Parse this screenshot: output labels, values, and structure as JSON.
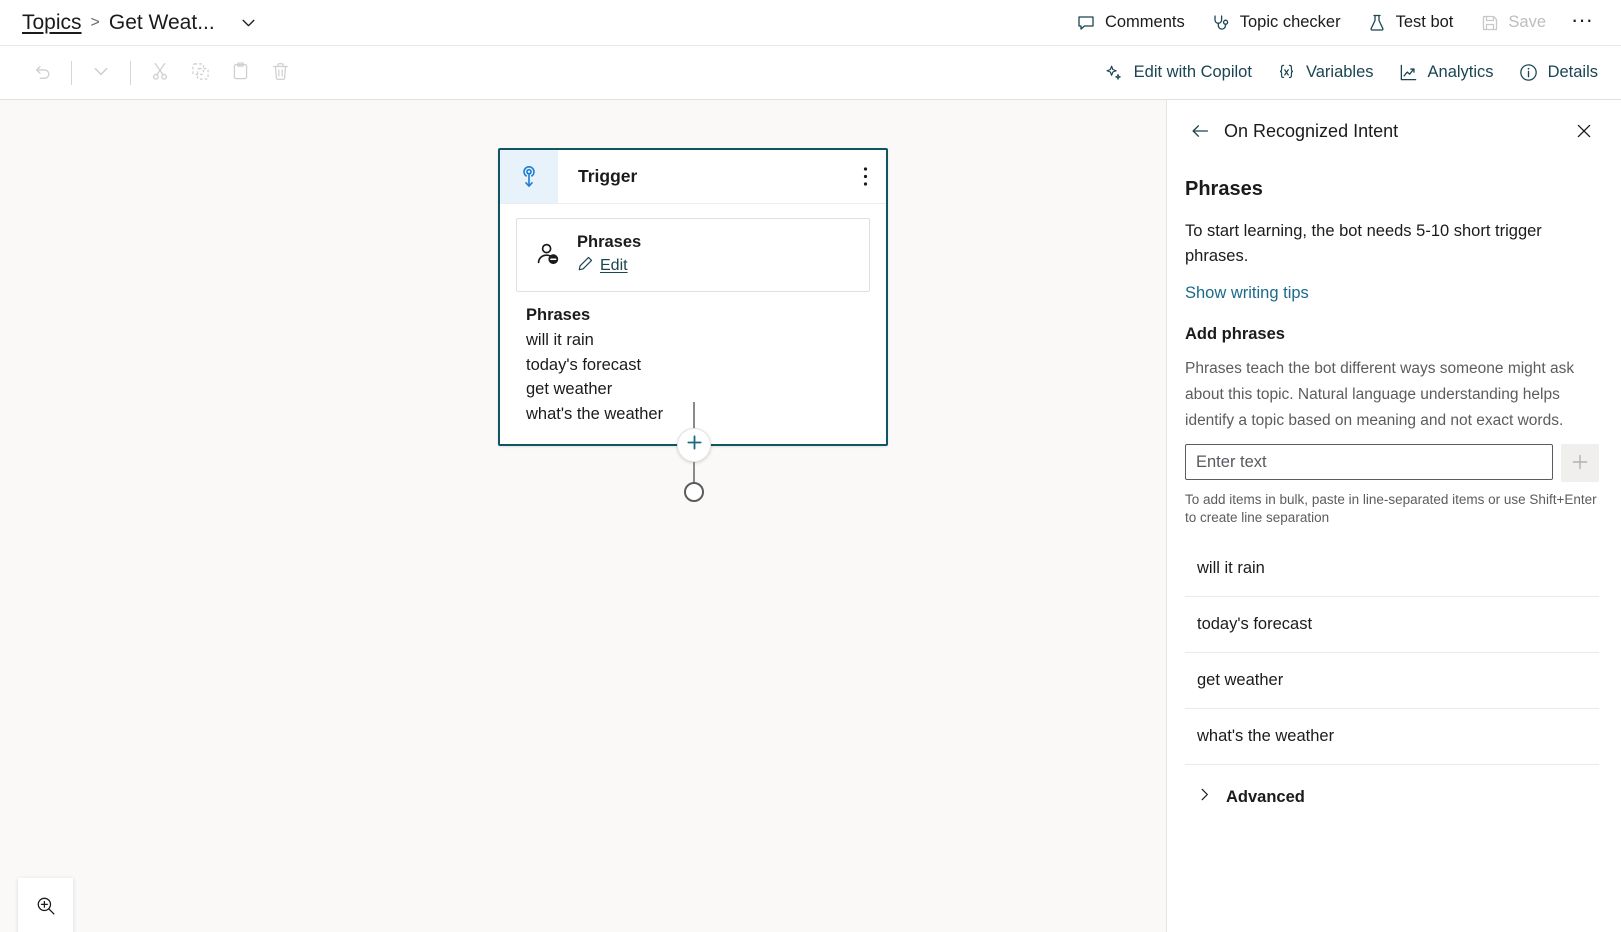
{
  "topbar": {
    "breadcrumb": {
      "root_label": "Topics",
      "separator": ">",
      "current_label": "Get Weat...",
      "caret_icon": "chevron-down-icon"
    },
    "actions": [
      {
        "label": "Comments",
        "icon": "comment-icon",
        "disabled": false
      },
      {
        "label": "Topic checker",
        "icon": "stethoscope-icon",
        "disabled": false
      },
      {
        "label": "Test bot",
        "icon": "flask-icon",
        "disabled": false
      },
      {
        "label": "Save",
        "icon": "save-icon",
        "disabled": true
      }
    ],
    "overflow_label": "···"
  },
  "toolbar2": {
    "left_icons": [
      {
        "name": "undo-icon",
        "disabled": true
      },
      {
        "name": "chevron-down-icon",
        "disabled": true
      },
      {
        "name": "cut-icon",
        "disabled": true
      },
      {
        "name": "copy-icon",
        "disabled": true
      },
      {
        "name": "paste-icon",
        "disabled": true
      },
      {
        "name": "delete-icon",
        "disabled": true
      }
    ],
    "right_actions": [
      {
        "label": "Edit with Copilot",
        "icon": "sparkle-icon"
      },
      {
        "label": "Variables",
        "icon": "braces-x-icon"
      },
      {
        "label": "Analytics",
        "icon": "chart-line-icon"
      },
      {
        "label": "Details",
        "icon": "info-circle-icon"
      }
    ]
  },
  "canvas": {
    "node": {
      "header_icon": "trigger-pin-icon",
      "header_title": "Trigger",
      "kebab_icon": "more-vertical-icon",
      "sub_card": {
        "icon": "person-message-icon",
        "title": "Phrases",
        "edit_label": "Edit",
        "edit_icon": "pencil-icon"
      },
      "phrases_title": "Phrases",
      "phrases": [
        "will it rain",
        "today's forecast",
        "get weather",
        "what's the weather"
      ]
    },
    "connector": {
      "add_icon": "plus-icon"
    },
    "zoom_control": {
      "icon": "zoom-in-icon"
    }
  },
  "panel": {
    "back_icon": "arrow-left-icon",
    "header_title": "On Recognized Intent",
    "close_icon": "close-icon",
    "section_title": "Phrases",
    "intro": "To start learning, the bot needs 5-10 short trigger phrases.",
    "writing_tips_link": "Show writing tips",
    "add_phrases_title": "Add phrases",
    "add_phrases_desc": "Phrases teach the bot different ways someone might ask about this topic. Natural language understanding helps identify a topic based on meaning and not exact words.",
    "input_value": "",
    "input_placeholder": "Enter text",
    "add_button_icon": "plus-icon",
    "bulk_hint": "To add items in bulk, paste in line-separated items or use Shift+Enter to create line separation",
    "phrase_items": [
      "will it rain",
      "today's forecast",
      "get weather",
      "what's the weather"
    ],
    "advanced_label": "Advanced",
    "advanced_icon": "chevron-right-icon"
  },
  "colors": {
    "node_border": "#0f5562",
    "node_icon_bg": "#e8f2fb",
    "accent_link": "#1b6a8a",
    "toolbar_action": "#1b4552"
  }
}
